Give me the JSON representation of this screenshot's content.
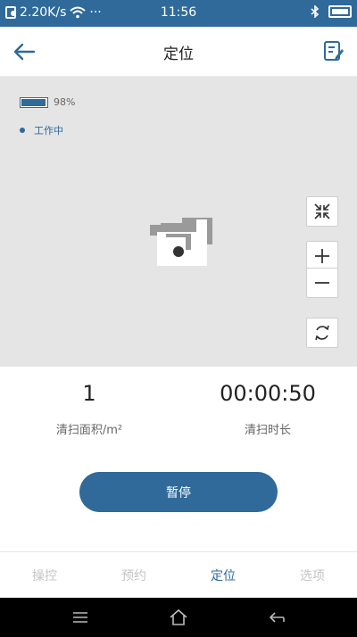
{
  "status_bar": {
    "network_speed": "2.20K/s",
    "more": "···",
    "time": "11:56"
  },
  "header": {
    "title": "定位"
  },
  "map": {
    "battery_percent": "98%",
    "battery_level": 0.98,
    "status": "工作中"
  },
  "stats": {
    "area_value": "1",
    "area_label": "清扫面积/m²",
    "duration_value": "00:00:50",
    "duration_label": "清扫时长"
  },
  "actions": {
    "pause_label": "暂停"
  },
  "tabs": [
    {
      "label": "操控"
    },
    {
      "label": "预约"
    },
    {
      "label": "定位"
    },
    {
      "label": "选项"
    }
  ],
  "colors": {
    "accent": "#2f6a9a",
    "map_background": "#e5e5e5",
    "inactive_tab": "#c4c4c4"
  },
  "icons": [
    "sim-icon",
    "wifi-icon",
    "bluetooth-icon",
    "battery-icon",
    "back-arrow-icon",
    "edit-icon",
    "shrink-icon",
    "plus-icon",
    "minus-icon",
    "rotate-icon",
    "menu-icon",
    "home-icon",
    "back-icon"
  ]
}
